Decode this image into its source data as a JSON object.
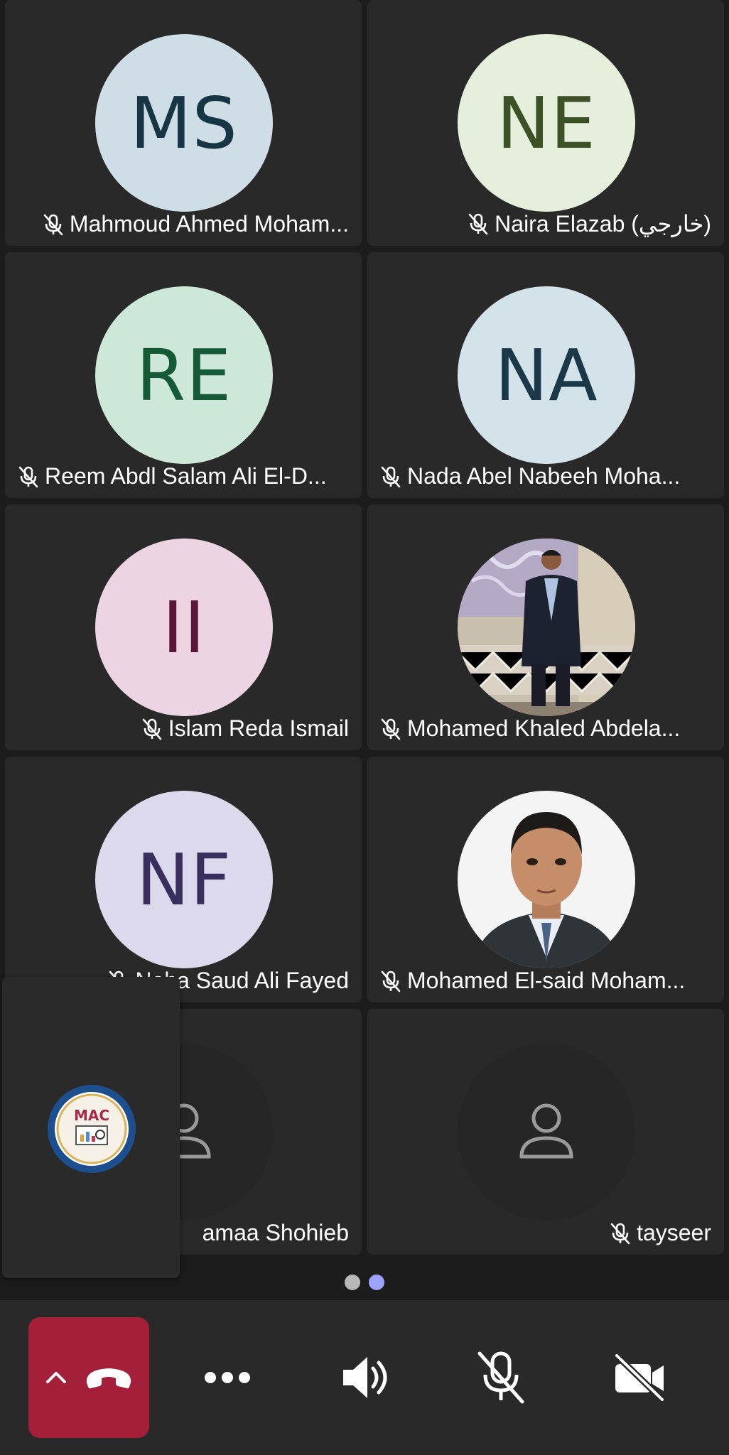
{
  "participants": [
    {
      "initials": "MS",
      "name": "Mahmoud Ahmed Moham...",
      "muted": true,
      "avatar_bg": "#cfdde6",
      "avatar_fg": "#173645",
      "align": "right"
    },
    {
      "initials": "NE",
      "name": "Naira Elazab (خارجي)",
      "muted": true,
      "avatar_bg": "#e6efdc",
      "avatar_fg": "#3d5126",
      "align": "right"
    },
    {
      "initials": "RE",
      "name": "Reem Abdl Salam Ali El-D...",
      "muted": true,
      "avatar_bg": "#cde8d9",
      "avatar_fg": "#155a37",
      "align": "left"
    },
    {
      "initials": "NA",
      "name": "Nada Abel Nabeeh Moha...",
      "muted": true,
      "avatar_bg": "#d4e2ea",
      "avatar_fg": "#1a3848",
      "align": "left"
    },
    {
      "initials": "II",
      "name": "Islam Reda Ismail",
      "muted": true,
      "avatar_bg": "#ecd4e2",
      "avatar_fg": "#5a1637",
      "align": "right"
    },
    {
      "initials": "",
      "name": "Mohamed Khaled Abdela...",
      "muted": true,
      "photo": "person-photo-standing",
      "align": "left"
    },
    {
      "initials": "NF",
      "name": "Noha Saud Ali Fayed",
      "muted": true,
      "avatar_bg": "#ddd9ec",
      "avatar_fg": "#3a2e5e",
      "align": "right"
    },
    {
      "initials": "",
      "name": "Mohamed El-said Moham...",
      "muted": true,
      "photo": "person-photo-portrait",
      "align": "left"
    },
    {
      "initials": "",
      "name": "amaa Shohieb",
      "muted": false,
      "placeholder": "person-outline-icon",
      "align": "right"
    },
    {
      "initials": "",
      "name": "tayseer",
      "muted": true,
      "placeholder": "person-outline-icon",
      "align": "right"
    }
  ],
  "self_view": {
    "logo_text": "MAC"
  },
  "pager": {
    "pages": 2,
    "active_index": 1
  },
  "toolbar": {
    "end_call_icon": "hang-up-icon",
    "chevron_icon": "chevron-up-icon",
    "more_icon": "more-horizontal-icon",
    "speaker_icon": "speaker-icon",
    "mic_icon": "mic-off-icon",
    "camera_icon": "camera-off-icon"
  },
  "colors": {
    "background": "#1c1c1c",
    "tile": "#292929",
    "end_call": "#a4203a",
    "pager_active": "#9ea2ff",
    "pager_inactive": "#b8b8b8"
  }
}
